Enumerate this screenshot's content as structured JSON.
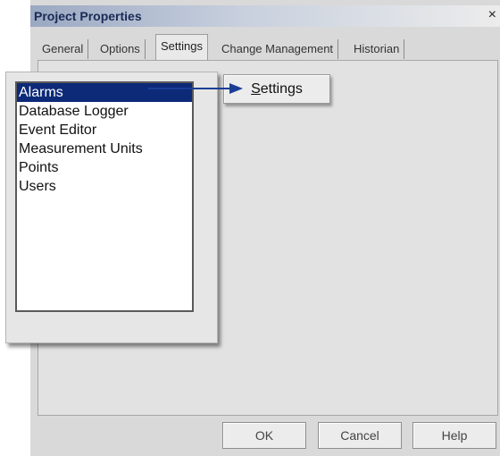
{
  "window": {
    "title": "Project Properties",
    "close_glyph": "×"
  },
  "tabs": [
    {
      "label": "General"
    },
    {
      "label": "Options"
    },
    {
      "label": "Settings"
    },
    {
      "label": "Change Management"
    },
    {
      "label": "Historian"
    }
  ],
  "active_tab": "Settings",
  "settings_list": {
    "items": [
      {
        "label": "Alarms"
      },
      {
        "label": "Database Logger"
      },
      {
        "label": "Event Editor"
      },
      {
        "label": "Measurement Units"
      },
      {
        "label": "Points"
      },
      {
        "label": "Users"
      }
    ],
    "selected": "Alarms"
  },
  "settings_button": {
    "label_first": "S",
    "label_rest": "ettings"
  },
  "footer": {
    "ok_label": "OK",
    "cancel_label": "Cancel",
    "help_label": "Help"
  },
  "colors": {
    "selection": "#0d2a78",
    "arrow": "#1a3d96"
  }
}
